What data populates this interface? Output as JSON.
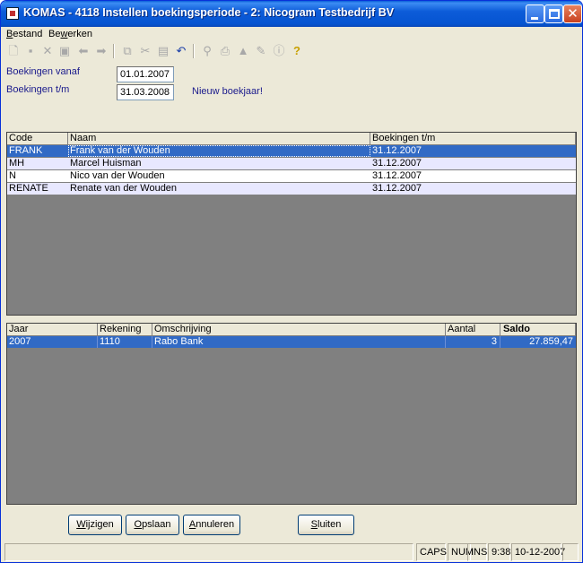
{
  "window": {
    "title": "KOMAS - 4118 Instellen boekingsperiode - 2: Nicogram Testbedrijf BV"
  },
  "menu": [
    {
      "label_acc": "B",
      "label_rest": "estand"
    },
    {
      "label_pre": "Be",
      "label_acc": "w",
      "label_rest": "erken"
    }
  ],
  "toolbar": {
    "icons": [
      "new-icon",
      "save-icon",
      "delete-icon",
      "save-as-icon",
      "previous-icon",
      "next-icon",
      "copy-icon",
      "cut-icon",
      "paste-icon",
      "undo-icon",
      "find-icon",
      "print-icon",
      "bell-icon",
      "edit-note-icon",
      "info-icon",
      "help-icon"
    ]
  },
  "form": {
    "from_label": "Boekingen vanaf",
    "from_value": "01.01.2007",
    "to_label": "Boekingen t/m",
    "to_value": "31.03.2008",
    "note": "Nieuw boekjaar!"
  },
  "users_grid": {
    "headers": [
      "Code",
      "Naam",
      "Boekingen t/m"
    ],
    "rows": [
      [
        "FRANK",
        "Frank van der Wouden",
        "31.12.2007"
      ],
      [
        "MH",
        "Marcel Huisman",
        "31.12.2007"
      ],
      [
        "N",
        "Nico van der Wouden",
        "31.12.2007"
      ],
      [
        "RENATE",
        "Renate van der Wouden",
        "31.12.2007"
      ]
    ],
    "selected_row": 0
  },
  "accounts_grid": {
    "headers": [
      "Jaar",
      "Rekening",
      "Omschrijving",
      "Aantal",
      "Saldo"
    ],
    "rows": [
      [
        "2007",
        "1110",
        "Rabo Bank",
        "3",
        "27.859,47"
      ]
    ],
    "selected_row": 0
  },
  "buttons": {
    "wijzigen": {
      "pre": "",
      "acc": "W",
      "rest": "ijzigen"
    },
    "opslaan": {
      "pre": "",
      "acc": "O",
      "rest": "pslaan"
    },
    "annuleren": {
      "pre": "",
      "acc": "A",
      "rest": "nnuleren"
    },
    "sluiten": {
      "pre": "",
      "acc": "S",
      "rest": "luiten"
    }
  },
  "status": {
    "caps": "CAPS",
    "num": "NUM",
    "ins": "INS",
    "time": "9:38",
    "date": "10-12-2007"
  },
  "colors": {
    "selection": "#316ac5",
    "row_alt": "#e8e8ff",
    "grid_bg": "#808080",
    "label_blue": "#1a1a8c"
  }
}
